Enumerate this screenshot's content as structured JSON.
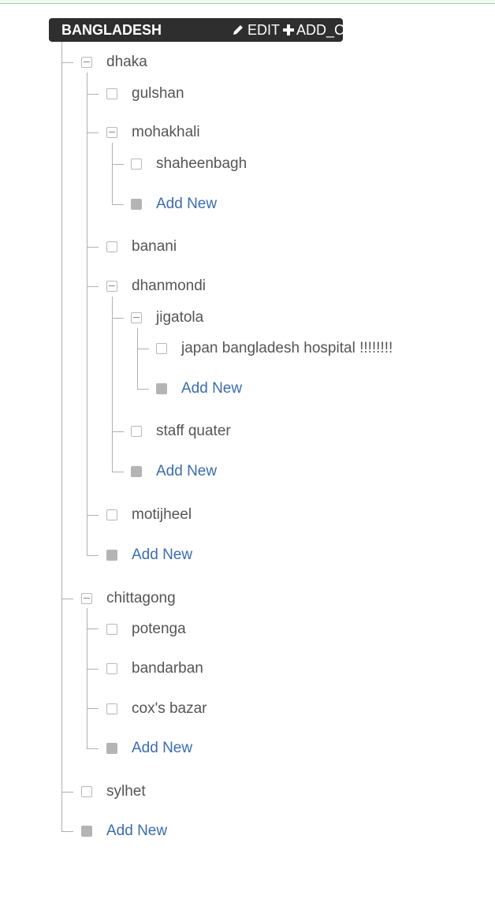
{
  "root": {
    "title": "BANGLADESH",
    "edit_label": "EDIT",
    "add_child_label": "ADD_CHILD"
  },
  "tree": {
    "dhaka": "dhaka",
    "gulshan": "gulshan",
    "mohakhali": "mohakhali",
    "shaheenbagh": "shaheenbagh",
    "banani": "banani",
    "dhanmondi": "dhanmondi",
    "jigatola": "jigatola",
    "japan": "japan bangladesh hospital !!!!!!!!",
    "staff": "staff quater",
    "motijheel": "motijheel",
    "chittagong": "chittagong",
    "potenga": "potenga",
    "bandarban": "bandarban",
    "coxs": "cox's bazar",
    "sylhet": "sylhet",
    "add_new": "Add New"
  },
  "colors": {
    "link": "#3b6cb0",
    "text": "#555555",
    "line": "#b0b0b0",
    "header_bg": "#2e2e2e"
  }
}
